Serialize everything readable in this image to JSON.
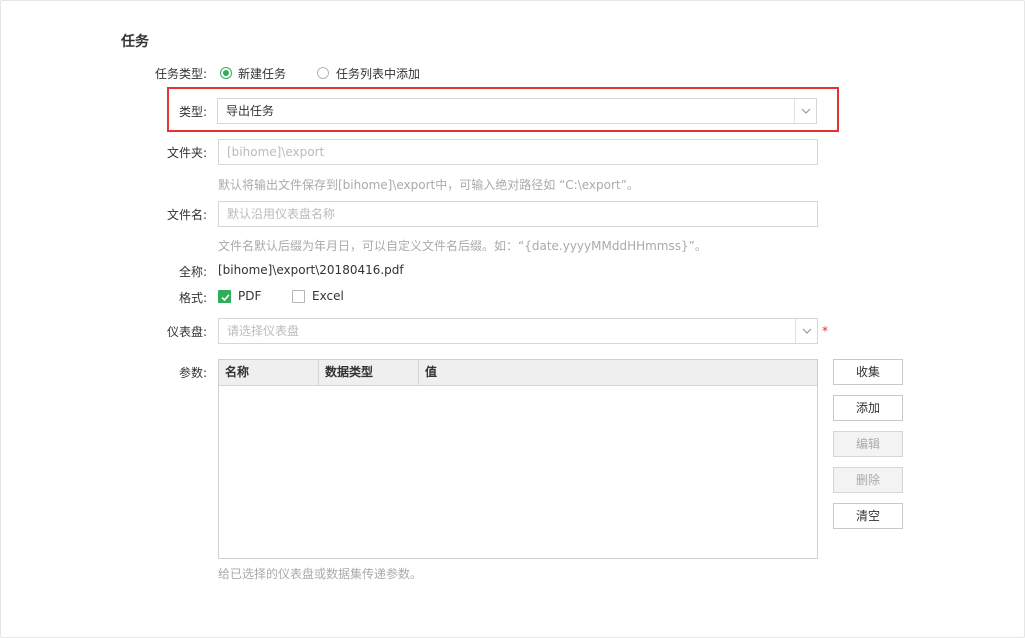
{
  "section": {
    "title": "任务"
  },
  "task_kind": {
    "label": "任务类型:",
    "options": [
      {
        "label": "新建任务",
        "selected": true
      },
      {
        "label": "任务列表中添加",
        "selected": false
      }
    ]
  },
  "type": {
    "label": "类型:",
    "value": "导出任务"
  },
  "folder": {
    "label": "文件夹:",
    "placeholder": "[bihome]\\export",
    "hint": "默认将输出文件保存到[bihome]\\export中，可输入绝对路径如 “C:\\export”。"
  },
  "filename": {
    "label": "文件名:",
    "placeholder": "默认沿用仪表盘名称",
    "hint": "文件名默认后缀为年月日，可以自定义文件名后缀。如：“{date.yyyyMMddHHmmss}”。"
  },
  "fullname": {
    "label": "全称:",
    "value": "[bihome]\\export\\20180416.pdf"
  },
  "format": {
    "label": "格式:",
    "options": [
      {
        "label": "PDF",
        "checked": true
      },
      {
        "label": "Excel",
        "checked": false
      }
    ]
  },
  "dashboard": {
    "label": "仪表盘:",
    "placeholder": "请选择仪表盘",
    "required_mark": "*"
  },
  "params": {
    "label": "参数:",
    "columns": [
      "名称",
      "数据类型",
      "值"
    ],
    "hint": "给已选择的仪表盘或数据集传递参数。"
  },
  "buttons": {
    "collect": "收集",
    "add": "添加",
    "edit": "编辑",
    "delete": "删除",
    "clear": "清空"
  },
  "colors": {
    "accent": "#2fae5a",
    "highlight": "#e53333"
  },
  "icons": {
    "dropdown": "chevron-down-icon",
    "check": "check-icon"
  }
}
